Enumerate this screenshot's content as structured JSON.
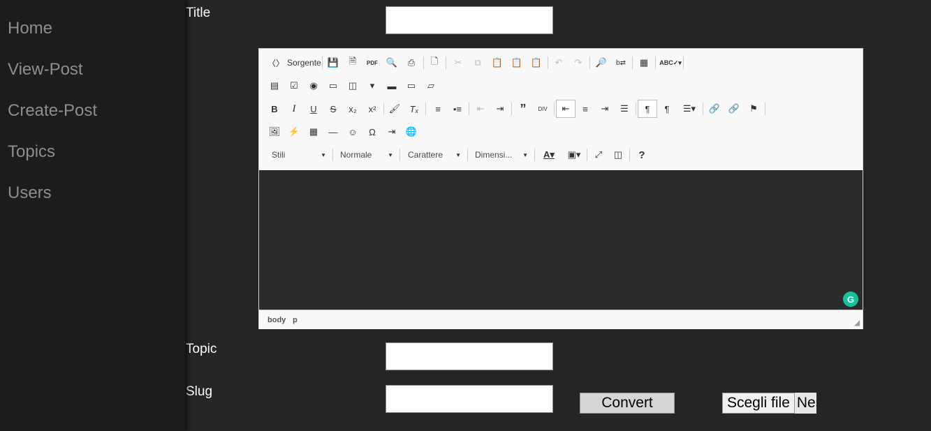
{
  "nav": {
    "items": [
      {
        "label": "Home"
      },
      {
        "label": "View-Post"
      },
      {
        "label": "Create-Post"
      },
      {
        "label": "Topics"
      },
      {
        "label": "Users"
      }
    ]
  },
  "form": {
    "title_label": "Title",
    "title_value": "",
    "topic_label": "Topic",
    "topic_value": "",
    "slug_label": "Slug",
    "slug_value": "",
    "convert_label": "Convert",
    "file_button_label": "Scegli file",
    "file_status": "Nessun file selezionato"
  },
  "editor": {
    "source_label": "Sorgente",
    "styles_combo": "Stili",
    "format_combo": "Normale",
    "font_combo": "Carattere",
    "size_combo": "Dimensi...",
    "element_path": [
      "body",
      "p"
    ],
    "content": ""
  },
  "colors": {
    "background": "#252525",
    "sidebar": "#1c1c1c",
    "nav_text": "#8e8e8e",
    "editor_area": "#2b2b2b",
    "grammarly": "#15c39a"
  }
}
